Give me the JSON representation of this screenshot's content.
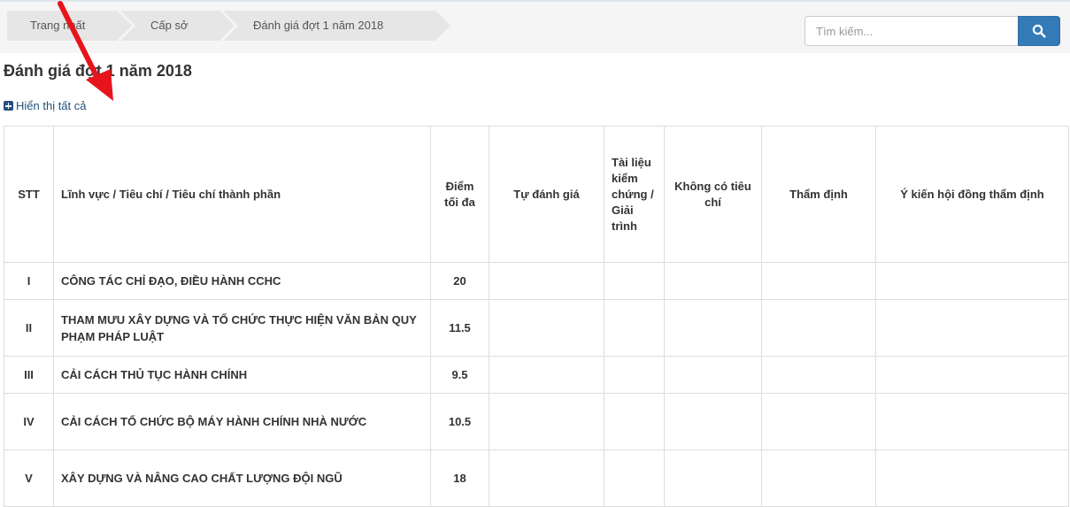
{
  "breadcrumb": [
    "Trang nhất",
    "Cấp sở",
    "Đánh giá đợt 1 năm 2018"
  ],
  "search": {
    "placeholder": "Tìm kiếm..."
  },
  "page_title": "Đánh giá đợt 1 năm 2018",
  "show_all_label": "Hiển thị tất cả",
  "table": {
    "headers": {
      "stt": "STT",
      "field": "Lĩnh vực / Tiêu chí / Tiêu chí thành phần",
      "max_score": "Điểm tối đa",
      "self_eval": "Tự đánh giá",
      "evidence": "Tài liệu kiểm chứng / Giải trình",
      "no_criterion": "Không có tiêu chí",
      "appraisal": "Thẩm định",
      "council_opinion": "Ý kiến hội đồng thẩm định"
    },
    "rows": [
      {
        "stt": "I",
        "name": "CÔNG TÁC CHỈ ĐẠO, ĐIỀU HÀNH CCHC",
        "max": "20"
      },
      {
        "stt": "II",
        "name": "THAM MƯU XÂY DỰNG VÀ TỔ CHỨC THỰC HIỆN VĂN BẢN QUY PHẠM PHÁP LUẬT",
        "max": "11.5"
      },
      {
        "stt": "III",
        "name": "CẢI CÁCH THỦ TỤC HÀNH CHÍNH",
        "max": "9.5"
      },
      {
        "stt": "IV",
        "name": "CẢI CÁCH TỔ CHỨC BỘ MÁY HÀNH CHÍNH NHÀ NƯỚC",
        "max": "10.5"
      },
      {
        "stt": "V",
        "name": "XÂY DỰNG VÀ NÂNG CAO CHẤT LƯỢNG ĐỘI NGŨ",
        "max": "18"
      }
    ]
  },
  "colors": {
    "accent": "#337ab7",
    "annotation_arrow": "#e8141b",
    "link": "#23527c"
  },
  "icons": {
    "search": "search-icon",
    "show_all": "plus-square-icon",
    "arrow": "red-arrow-annotation"
  }
}
